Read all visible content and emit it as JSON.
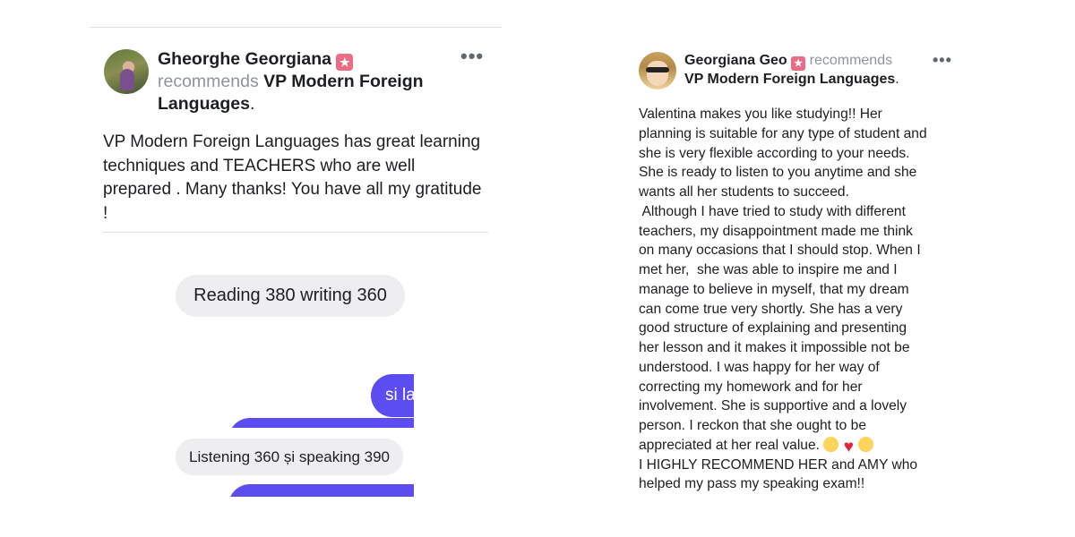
{
  "left_post": {
    "author": "Gheorghe Georgiana",
    "recommends": "recommends",
    "page_name": "VP Modern Foreign Languages",
    "period": ".",
    "more_glyph": "•••",
    "body": "VP Modern Foreign Languages has great learning techniques and TEACHERS who are well prepared . Many thanks! You have all my gratitude !",
    "chat": {
      "bubble_1": "Reading 380 writing 360",
      "purple_bubble": "si la",
      "bubble_2": "Listening 360 și speaking 390"
    }
  },
  "right_post": {
    "author": "Georgiana Geo",
    "recommends": "recommends",
    "page_name": "VP Modern Foreign Languages",
    "period": ".",
    "more_glyph": "•••",
    "body_lines": [
      "Valentina makes you like studying!! Her",
      "planning is suitable for any type of student and",
      "she is very flexible according to your needs.",
      "She is ready to listen to you anytime and she",
      "wants all her students to succeed.",
      " Although I have tried to study with different",
      "teachers, my disappointment made me think",
      "on many occasions that I should stop. When I",
      "met her,  she was able to inspire me and I",
      "manage to believe in myself, that my dream",
      "can come true very shortly. She has a very",
      "good structure of explaining and presenting",
      "her lesson and it makes it impossible not be",
      "understood. I was happy for her way of",
      "correcting my homework and for her",
      "involvement. She is supportive and a lovely",
      "person. I reckon that she ought to be",
      "appreciated at her real value.",
      "I HIGHLY RECOMMEND HER and AMY who",
      "helped my pass my speaking exam!!"
    ],
    "emoji_icons": [
      "smiling-face-icon",
      "red-heart-icon",
      "smiling-face-icon"
    ]
  },
  "colors": {
    "recommend_badge": "#ec6c86",
    "chat_purple": "#5b4df0",
    "chat_gray": "#eeeef0",
    "muted_text": "#8d949e"
  }
}
